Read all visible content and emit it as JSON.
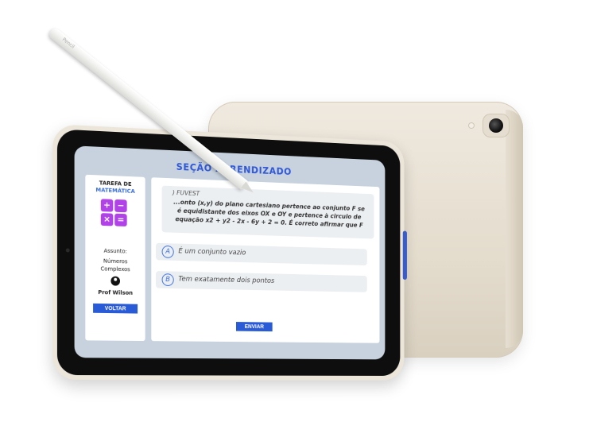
{
  "app": {
    "title": "SEÇÃO APRENDIZADO"
  },
  "sidebar": {
    "title": "TAREFA DE",
    "subtitle": "MATEMÁTICA",
    "calculator_icon": "calculator-icon",
    "assunto_label": "Assunto:",
    "topic_line1": "Números",
    "topic_line2": "Complexos",
    "professor_icon": "user-icon",
    "professor_name": "Prof Wilson",
    "back_button": "VOLTAR"
  },
  "question": {
    "source": ") FUVEST",
    "text": "...onto (x,y) do plano cartesiano pertence ao conjunto F se é equidistante dos eixos  OX e  OY e pertence à circulo de equação x2 + y2 - 2x - 6y + 2 = 0. É correto afirmar que F"
  },
  "options": [
    {
      "letter": "A",
      "text": "É um conjunto vazio"
    },
    {
      "letter": "B",
      "text": "Tem exatamente dois pontos"
    }
  ],
  "submit_button": "ENVIAR",
  "pencil": {
    "label": "Pencil"
  },
  "colors": {
    "accent": "#2a5bd7",
    "screen_bg": "#c7d2de",
    "device_body": "#ece6da"
  }
}
